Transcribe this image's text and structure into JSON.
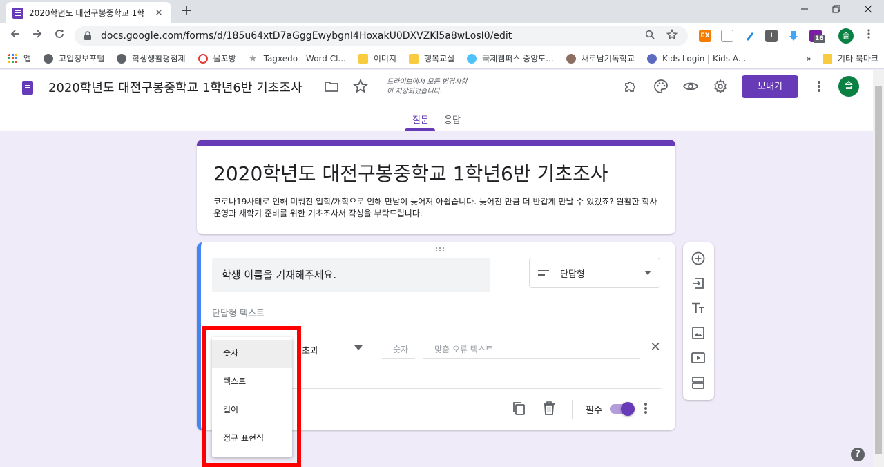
{
  "browser": {
    "tab_title": "2020학년도 대전구봉중학교 1학",
    "tab_close": "✕",
    "new_tab": "+",
    "url": "docs.google.com/forms/d/185u64xtD7aGggEwybgnI4HoxakU0DXVZKl5a8wLosI0/edit",
    "extension_badge": "16",
    "profile_initial": "솔",
    "ext_labels": [
      "EX",
      "I"
    ]
  },
  "bookmarks": {
    "apps_label": "앱",
    "items": [
      {
        "label": "고입정보포털",
        "color": "#5f6368"
      },
      {
        "label": "학생생활평점제",
        "color": "#5f6368"
      },
      {
        "label": "물꼬방",
        "color": "#e53935"
      },
      {
        "label": "Tagxedo - Word Cl...",
        "color": "#9e9e9e"
      },
      {
        "label": "이미지",
        "color": "#f9cb3f"
      },
      {
        "label": "행복교실",
        "color": "#f9cb3f"
      },
      {
        "label": "국제캠퍼스 중앙도...",
        "color": "#4fc3f7"
      },
      {
        "label": "새로남기독학교",
        "color": "#8d6e63"
      },
      {
        "label": "Kids Login | Kids A...",
        "color": "#5c6bc0"
      }
    ],
    "overflow": "»",
    "other_bookmarks": "기타 북마크"
  },
  "forms_header": {
    "doc_title": "2020학년도 대전구봉중학교 1학년6반 기초조사",
    "save_status_line1": "드라이브에서 모든 변경사항",
    "save_status_line2": "이 저장되었습니다.",
    "send_label": "보내기",
    "account_initial": "솔",
    "tabs": [
      {
        "label": "질문",
        "active": true
      },
      {
        "label": "응답",
        "active": false
      }
    ]
  },
  "form": {
    "title": "2020학년도 대전구봉중학교 1학년6반 기초조사",
    "description": "코로나19사태로 인해 미뤄진 입학/개학으로 인해 만남이 늦어져 아쉽습니다. 늦어진 만큼 더 반갑게 만날 수 있겠죠? 원활한 학사운영과 새학기 준비를 위한 기초조사서 작성을 부탁드립니다."
  },
  "question": {
    "title": "학생 이름을 기재해주세요.",
    "type": "단답형",
    "answer_placeholder": "단답형 텍스트",
    "validation": {
      "condition": "초과",
      "number_placeholder": "숫자",
      "error_placeholder": "맞춤 오류 텍스트",
      "close": "✕"
    },
    "required_label": "필수",
    "required": true
  },
  "validation_menu": {
    "items": [
      {
        "label": "숫자",
        "selected": true
      },
      {
        "label": "텍스트",
        "selected": false
      },
      {
        "label": "길이",
        "selected": false
      },
      {
        "label": "정규 표현식",
        "selected": false
      }
    ]
  },
  "colors": {
    "accent": "#673ab7",
    "background": "#f0ebf8",
    "highlight": "#ff0000",
    "active_question": "#4285f4"
  },
  "help": "?"
}
